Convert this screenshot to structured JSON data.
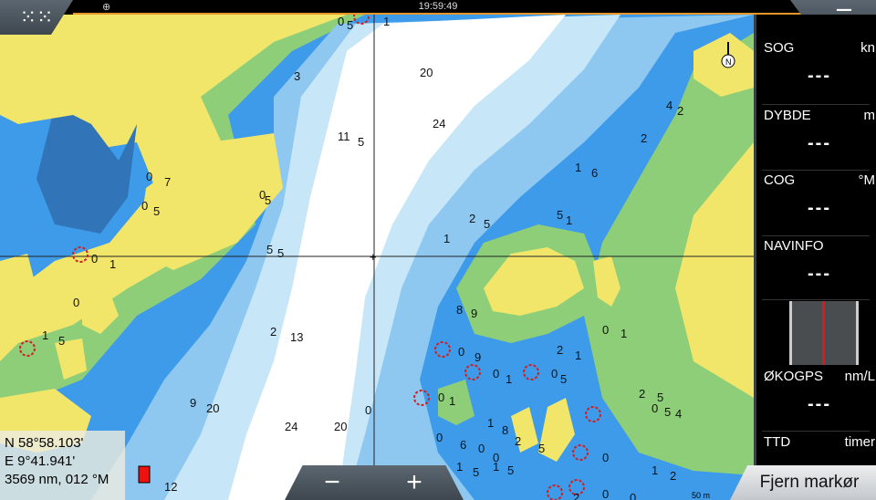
{
  "status_bar": {
    "clock": "19:59:49",
    "globe_icon": "globe-icon"
  },
  "buttons": {
    "apps_icon": "grid-icon",
    "menu_icon": "hamburger-icon",
    "zoom_out": "−",
    "zoom_in": "+",
    "remove_cursor": "Fjern markør"
  },
  "cursor_info": {
    "lat": "N  58°58.103'",
    "lon": "E  9°41.941'",
    "range_bearing": "3569 nm, 012 °M"
  },
  "data_panel": [
    {
      "label": "SOG",
      "unit": "kn",
      "value": "---"
    },
    {
      "label": "DYBDE",
      "unit": "m",
      "value": "---"
    },
    {
      "label": "COG",
      "unit": "°M",
      "value": "---"
    },
    {
      "label": "NAVINFO",
      "unit": "",
      "value": "---"
    },
    {
      "label": "ØKOGPS",
      "unit": "nm/L",
      "value": "---"
    },
    {
      "label": "TTD",
      "unit": "timer",
      "value": ""
    }
  ],
  "map": {
    "north_label": "N",
    "scale_label": "50 m",
    "depths": [
      "0",
      "5",
      "1",
      "3",
      "20",
      "24",
      "11",
      "5",
      "0",
      "5",
      "2",
      "4",
      "2",
      "1",
      "6",
      "0",
      "7",
      "0",
      "5",
      "2",
      "5",
      "1",
      "0",
      "1",
      "8",
      "9",
      "5",
      "5",
      "0",
      "5",
      "1",
      "2",
      "13",
      "2",
      "1",
      "0",
      "1",
      "0",
      "9",
      "0",
      "1",
      "0",
      "1",
      "0",
      "5",
      "1",
      "5",
      "9",
      "20",
      "24",
      "20",
      "0",
      "1",
      "8",
      "0",
      "6",
      "0",
      "0",
      "2",
      "5",
      "1",
      "5",
      "1",
      "5",
      "5",
      "0",
      "5",
      "0",
      "4",
      "1",
      "2",
      "0",
      "2",
      "0",
      "2",
      "12"
    ],
    "colors": {
      "land": "#f2e66a",
      "drying": "#8fce79",
      "deep_blue": "#3d9be9",
      "mid_blue": "#8ec8f0",
      "light_blue": "#c7e6f8",
      "deep_water": "#ffffff",
      "rock_symbol": "#d21f1f"
    }
  }
}
